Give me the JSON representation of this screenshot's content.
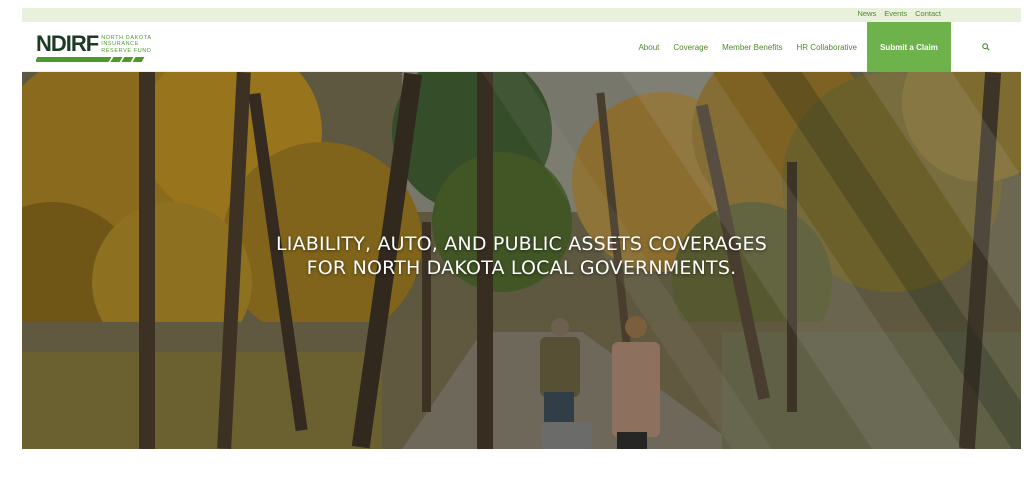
{
  "utility_nav": [
    "News",
    "Events",
    "Contact"
  ],
  "logo": {
    "mark": "NDIRF",
    "lines": [
      "NORTH DAKOTA",
      "INSURANCE",
      "RESERVE FUND"
    ]
  },
  "main_nav": {
    "items": [
      "About",
      "Coverage",
      "Member Benefits",
      "HR Collaborative"
    ],
    "cta": "Submit a Claim",
    "search_icon": "search-icon"
  },
  "hero": {
    "line1": "LIABILITY, AUTO, AND PUBLIC ASSETS COVERAGES",
    "line2": "FOR NORTH DAKOTA LOCAL GOVERNMENTS."
  },
  "colors": {
    "brand_green": "#4c9a2a",
    "button_green": "#6db24a",
    "link_green": "#4e8a2e",
    "utility_bg": "#e8f1dc"
  }
}
